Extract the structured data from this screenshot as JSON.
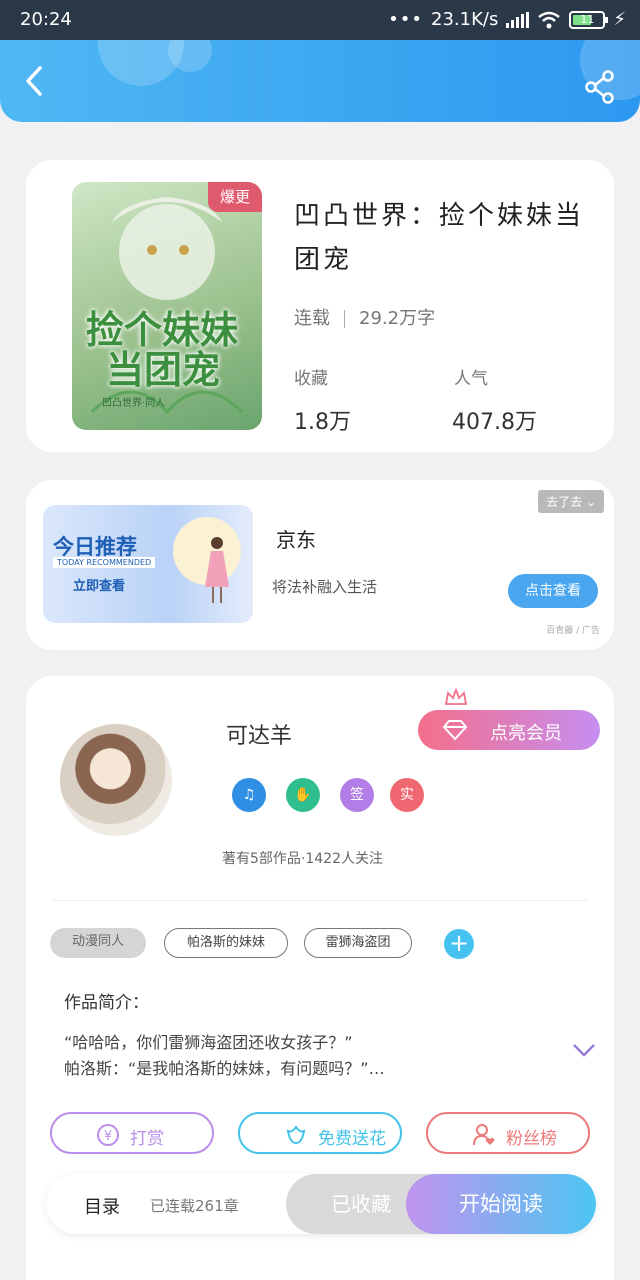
{
  "status_bar": {
    "time": "20:24",
    "network_speed": "23.1K/s",
    "battery_level": "11"
  },
  "book": {
    "cover_badge": "爆更",
    "cover_title": "捡个妹妹",
    "cover_title_line2": "当团宠",
    "cover_subtitle": "凹凸世界·同人",
    "title": "凹凸世界：捡个妹妹当团宠",
    "status": "连载",
    "word_count": "29.2万字",
    "favorites_label": "收藏",
    "favorites_value": "1.8万",
    "popularity_label": "人气",
    "popularity_value": "407.8万"
  },
  "ad": {
    "banner_title": "今日推荐",
    "banner_en": "TODAY RECOMMENDED",
    "banner_cta": "立即查看",
    "close_label": "去了去",
    "title": "京东",
    "description": "将法补融入生活",
    "button_label": "点击查看",
    "source": "百青藤 / 广告"
  },
  "author": {
    "name": "可达羊",
    "vip_label": "点亮会员",
    "badges": [
      {
        "label": "♫",
        "color": "#2f8fe4"
      },
      {
        "label": "✋",
        "color": "#2fbf8f"
      },
      {
        "label": "签",
        "color": "#b27de6"
      },
      {
        "label": "实",
        "color": "#ef6770"
      }
    ],
    "meta": "著有5部作品·1422人关注"
  },
  "tags": [
    "动漫同人",
    "帕洛斯的妹妹",
    "雷狮海盗团"
  ],
  "intro": {
    "label": "作品简介：",
    "line1": "“哈哈哈，你们雷狮海盗团还收女孩子？”",
    "line2": "帕洛斯：“是我帕洛斯的妹妹，有问题吗？”…"
  },
  "actions": {
    "reward": {
      "label": "打赏",
      "color": "#b88ee8"
    },
    "flower": {
      "label": "免费送花",
      "color": "#43c3e8"
    },
    "fans": {
      "label": "粉丝榜",
      "color": "#ec7a7a"
    }
  },
  "bottom": {
    "toc_label": "目录",
    "toc_sub": "已连载261章",
    "collected_label": "已收藏",
    "start_label": "开始阅读"
  }
}
